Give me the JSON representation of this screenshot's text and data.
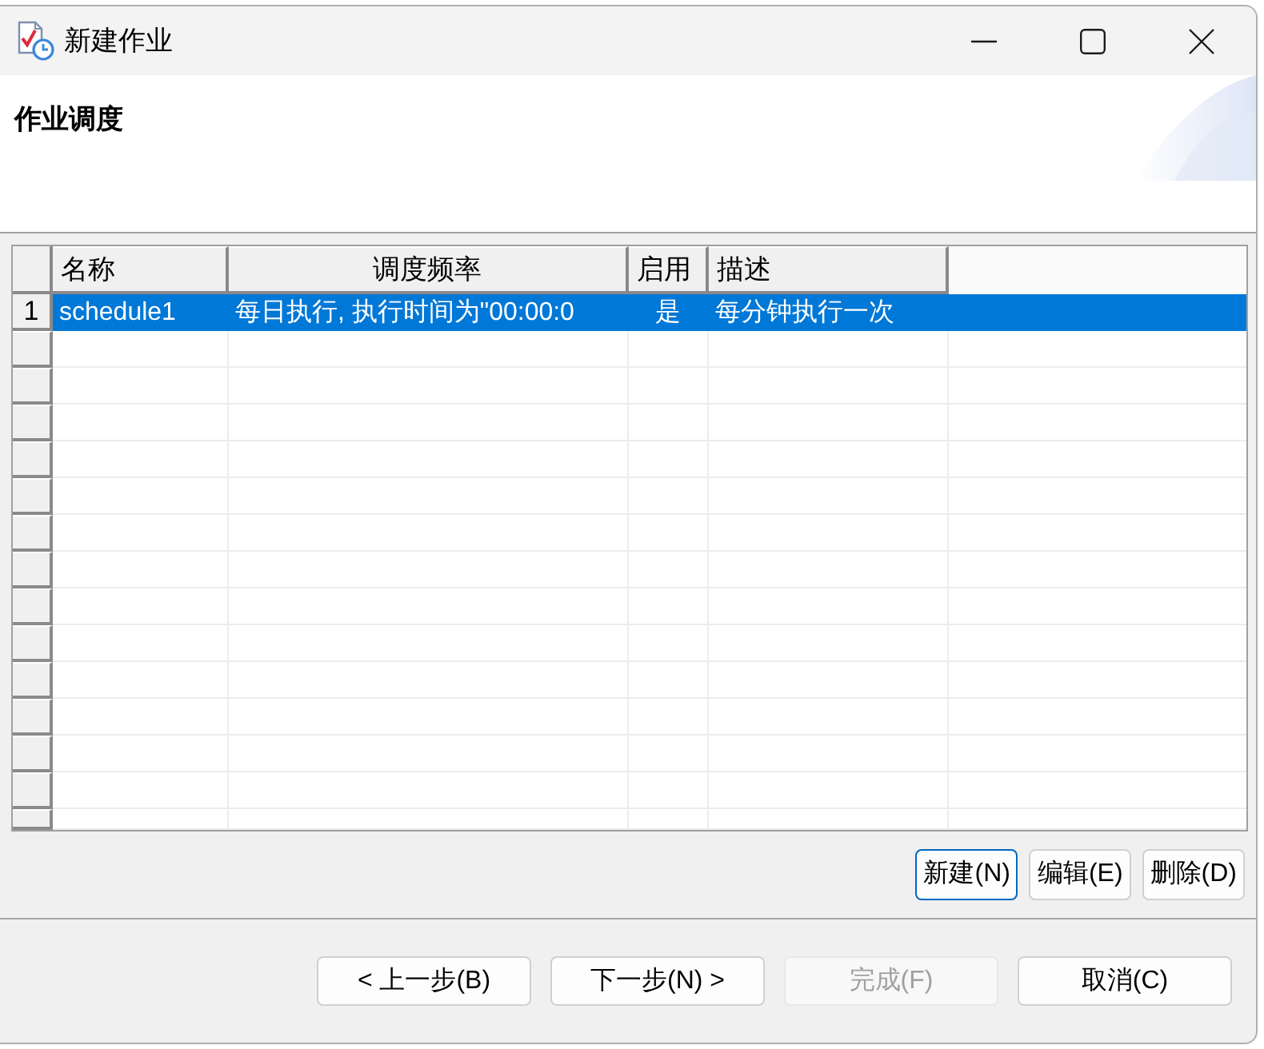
{
  "window": {
    "title": "新建作业"
  },
  "header": {
    "title": "作业调度"
  },
  "table": {
    "columns": [
      "名称",
      "调度频率",
      "启用",
      "描述"
    ],
    "rows": [
      {
        "index": "1",
        "cells": [
          "schedule1",
          "每日执行, 执行时间为\"00:00:0",
          "是",
          "每分钟执行一次"
        ],
        "selected": true
      }
    ]
  },
  "table_buttons": [
    {
      "label": "新建(N)",
      "focused": true
    },
    {
      "label": "编辑(E)",
      "focused": false
    },
    {
      "label": "删除(D)",
      "focused": false
    }
  ],
  "nav_buttons": [
    {
      "label": "< 上一步(B)",
      "disabled": false
    },
    {
      "label": "下一步(N) >",
      "disabled": false
    },
    {
      "label": "完成(F)",
      "disabled": true
    },
    {
      "label": "取消(C)",
      "disabled": false
    }
  ]
}
